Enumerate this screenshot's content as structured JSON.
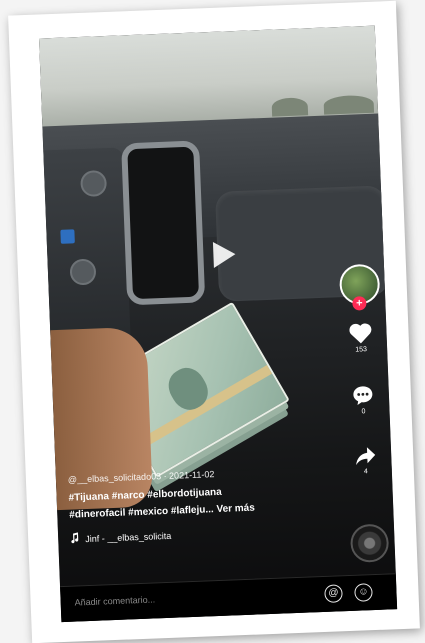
{
  "post": {
    "author": "@__elbas_solicitado03 · 2021-11-02",
    "hashtags_line1": "#Tijuana #narco #elbordotijuana",
    "hashtags_line2": "#dinerofacil #mexico #lafleju... Ver más",
    "sound": "Jinf - __elbas_solicita"
  },
  "rail": {
    "follow_symbol": "+",
    "likes": "153",
    "comments": "0",
    "shares": "4"
  },
  "comment_bar": {
    "placeholder": "Añadir comentario...",
    "mention_symbol": "@",
    "emoji_symbol": "☺"
  },
  "colors": {
    "accent": "#fe2c55",
    "text": "#ffffff"
  },
  "icons": [
    "play-icon",
    "heart-icon",
    "comment-icon",
    "share-icon",
    "music-note-icon",
    "mention-icon",
    "emoji-icon",
    "music-disc-icon"
  ]
}
